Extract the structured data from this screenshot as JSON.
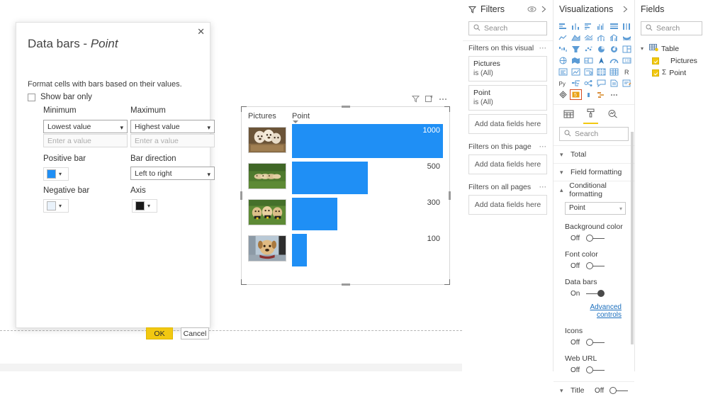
{
  "dialog": {
    "title_main": "Data bars",
    "title_sep": " - ",
    "title_field": "Point",
    "close_icon": "close-icon",
    "description": "Format cells with bars based on their values.",
    "show_bar_only_label": "Show bar only",
    "show_bar_only_checked": false,
    "minimum": {
      "label": "Minimum",
      "select_value": "Lowest value",
      "input_placeholder": "Enter a value",
      "input_value": ""
    },
    "maximum": {
      "label": "Maximum",
      "select_value": "Highest value",
      "input_placeholder": "Enter a value",
      "input_value": ""
    },
    "positive_bar": {
      "label": "Positive bar",
      "color": "#1f8ff5"
    },
    "negative_bar": {
      "label": "Negative bar",
      "color": "#e9f2fb"
    },
    "bar_direction": {
      "label": "Bar direction",
      "select_value": "Left to right"
    },
    "axis": {
      "label": "Axis",
      "color": "#1a1a1a"
    },
    "ok_label": "OK",
    "cancel_label": "Cancel",
    "ok_color": "#f2c811"
  },
  "visual": {
    "header_icons": [
      "filter-icon",
      "focus-mode-icon",
      "more-options-icon"
    ],
    "columns": [
      "Pictures",
      "Point"
    ],
    "sort_column": "Point",
    "bar_color": "#1f8ff5",
    "rows": [
      {
        "image": "puppies-in-basket",
        "value": "1000",
        "bar_pct": 100
      },
      {
        "image": "puppies-on-grass",
        "value": "500",
        "bar_pct": 50
      },
      {
        "image": "three-labrador-puppies",
        "value": "300",
        "bar_pct": 30
      },
      {
        "image": "puppy-with-scarf",
        "value": "100",
        "bar_pct": 10
      }
    ]
  },
  "filters": {
    "title": "Filters",
    "eye_icon": "hide-pane-eye-icon",
    "collapse_icon": "chevron-right-icon",
    "search_placeholder": "Search",
    "sections": [
      {
        "title": "Filters on this visual",
        "cards": [
          {
            "name": "Pictures",
            "value": "is (All)"
          },
          {
            "name": "Point",
            "value": "is (All)"
          }
        ],
        "dropzone": "Add data fields here"
      },
      {
        "title": "Filters on this page",
        "cards": [],
        "dropzone": "Add data fields here"
      },
      {
        "title": "Filters on all pages",
        "cards": [],
        "dropzone": "Add data fields here"
      }
    ]
  },
  "visualizations": {
    "title": "Visualizations",
    "collapse_icon": "chevron-right-icon",
    "selected_icon": "table-visual-icon",
    "icons": [
      "stacked-bar-chart-icon",
      "stacked-column-chart-icon",
      "clustered-bar-chart-icon",
      "clustered-column-chart-icon",
      "100-stacked-bar-chart-icon",
      "100-stacked-column-chart-icon",
      "line-chart-icon",
      "area-chart-icon",
      "stacked-area-chart-icon",
      "line-stacked-column-icon",
      "line-clustered-column-icon",
      "ribbon-chart-icon",
      "waterfall-chart-icon",
      "funnel-chart-icon",
      "scatter-chart-icon",
      "pie-chart-icon",
      "donut-chart-icon",
      "treemap-icon",
      "map-icon",
      "filled-map-icon",
      "shape-map-icon",
      "arcgis-map-icon",
      "gauge-icon",
      "card-icon",
      "multi-row-card-icon",
      "kpi-icon",
      "slicer-icon",
      "table-visual-icon",
      "matrix-icon",
      "r-script-visual-icon",
      "python-visual-icon",
      "decomposition-tree-icon",
      "key-influencers-icon",
      "q-and-a-icon",
      "paginated-report-icon",
      "smart-narrative-icon",
      "power-apps-icon",
      "selected-visual-icon",
      "bar-marker-icon",
      "power-automate-icon",
      "more-visuals-icon"
    ],
    "tabs": [
      {
        "name": "fields-tab",
        "icon": "fields-grid-icon",
        "active": false
      },
      {
        "name": "format-tab",
        "icon": "paint-roller-icon",
        "active": true
      },
      {
        "name": "analytics-tab",
        "icon": "magnifier-analytics-icon",
        "active": false
      }
    ],
    "search_placeholder": "Search",
    "sections": [
      {
        "label": "Total",
        "expanded": false
      },
      {
        "label": "Field formatting",
        "expanded": false
      },
      {
        "label": "Conditional formatting",
        "expanded": true
      }
    ],
    "conditional_formatting": {
      "field_select": "Point",
      "items": [
        {
          "label": "Background color",
          "state": "Off",
          "on": false
        },
        {
          "label": "Font color",
          "state": "Off",
          "on": false
        },
        {
          "label": "Data bars",
          "state": "On",
          "on": true
        }
      ],
      "advanced_link": "Advanced controls",
      "items_after": [
        {
          "label": "Icons",
          "state": "Off",
          "on": false
        },
        {
          "label": "Web URL",
          "state": "Off",
          "on": false
        }
      ]
    },
    "bottom_section": {
      "label": "Title",
      "state": "Off",
      "on": false
    }
  },
  "fields": {
    "title": "Fields",
    "search_placeholder": "Search",
    "tree": {
      "table_name": "Table",
      "table_icon": "table-icon",
      "items": [
        {
          "label": "Pictures",
          "checked": true,
          "measure": false
        },
        {
          "label": "Point",
          "checked": true,
          "measure": true,
          "sigma": "Σ"
        }
      ]
    }
  }
}
